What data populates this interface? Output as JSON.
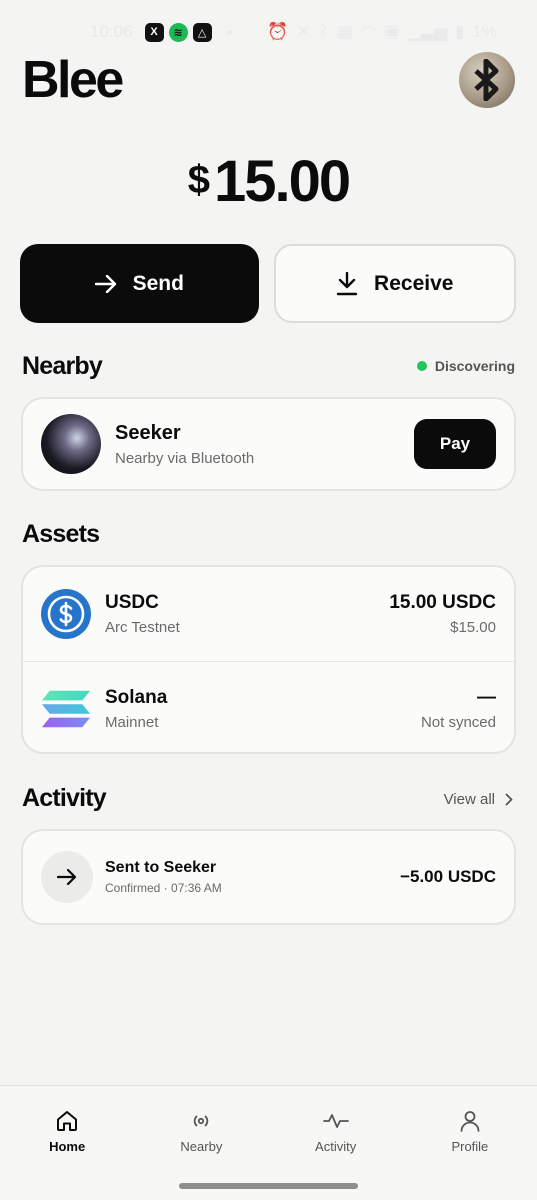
{
  "status_bar": {
    "time": "10:06",
    "app_icons": [
      "x-icon",
      "spotify-icon",
      "drive-icon"
    ],
    "battery": "1%"
  },
  "header": {
    "logo": "Blee",
    "avatar_icon": "bluetooth-icon"
  },
  "balance": {
    "currency": "$",
    "amount": "15.00"
  },
  "actions": {
    "send_label": "Send",
    "receive_label": "Receive"
  },
  "nearby": {
    "title": "Nearby",
    "status": "Discovering",
    "status_color": "#22c55e",
    "peer": {
      "name": "Seeker",
      "subtitle": "Nearby via Bluetooth",
      "pay_label": "Pay"
    }
  },
  "assets": {
    "title": "Assets",
    "items": [
      {
        "name": "USDC",
        "network": "Arc Testnet",
        "value": "15.00 USDC",
        "fiat": "$15.00",
        "icon": "usdc-icon",
        "color": "#2775ca"
      },
      {
        "name": "Solana",
        "network": "Mainnet",
        "value": "—",
        "fiat": "Not synced",
        "icon": "solana-icon"
      }
    ]
  },
  "activity": {
    "title": "Activity",
    "view_all": "View all",
    "items": [
      {
        "title": "Sent to Seeker",
        "subtitle": "Confirmed · 07:36 AM",
        "amount": "−5.00 USDC",
        "icon": "arrow-right-icon"
      }
    ]
  },
  "tabs": [
    {
      "label": "Home",
      "icon": "home-icon",
      "active": true
    },
    {
      "label": "Nearby",
      "icon": "nearby-icon",
      "active": false
    },
    {
      "label": "Activity",
      "icon": "activity-icon",
      "active": false
    },
    {
      "label": "Profile",
      "icon": "profile-icon",
      "active": false
    }
  ]
}
